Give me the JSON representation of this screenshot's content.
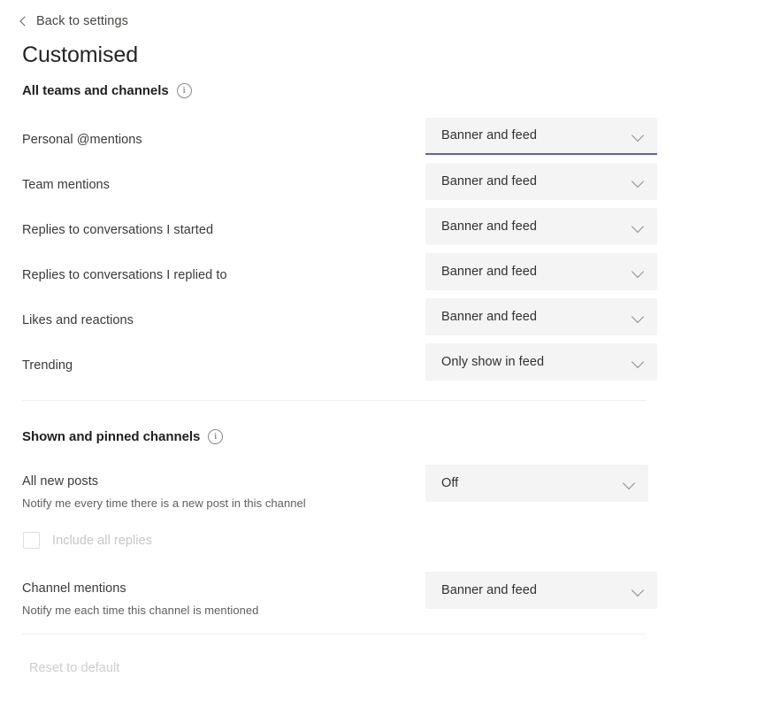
{
  "nav": {
    "back_label": "Back to settings",
    "back_icon": "chevron-left-icon"
  },
  "page_title": "Customised",
  "sections": [
    {
      "id": "all-teams-and-channels",
      "heading": "All teams and channels",
      "info_icon": "info-icon",
      "rows": [
        {
          "label": "Personal @mentions",
          "value": "Banner and feed",
          "focused": true
        },
        {
          "label": "Team mentions",
          "value": "Banner and feed",
          "focused": false
        },
        {
          "label": "Replies to conversations I started",
          "value": "Banner and feed",
          "focused": false
        },
        {
          "label": "Replies to conversations I replied to",
          "value": "Banner and feed",
          "focused": false
        },
        {
          "label": "Likes and reactions",
          "value": "Banner and feed",
          "focused": false
        },
        {
          "label": "Trending",
          "value": "Only show in feed",
          "focused": false
        }
      ]
    },
    {
      "id": "shown-and-pinned-channels",
      "heading": "Shown and pinned channels",
      "info_icon": "info-icon",
      "rows": [
        {
          "label": "All new posts",
          "sub": "Notify me every time there is a new post in this channel",
          "value": "Off"
        },
        {
          "label": "Channel mentions",
          "sub": "Notify me each time this channel is mentioned",
          "value": "Banner and feed"
        }
      ],
      "checkbox": {
        "label": "Include all replies",
        "checked": false,
        "disabled": true
      }
    }
  ],
  "footer": {
    "reset_label": "Reset to default",
    "reset_disabled": true
  },
  "colors": {
    "accent": "#6264a7",
    "dropdown_bg": "#f4f4f4",
    "page_bg": "#ffffff",
    "label_text": "#3b3a39",
    "sub_text": "#605e5c",
    "disabled_text": "#c8c6c4",
    "divider": "#f0efee"
  }
}
